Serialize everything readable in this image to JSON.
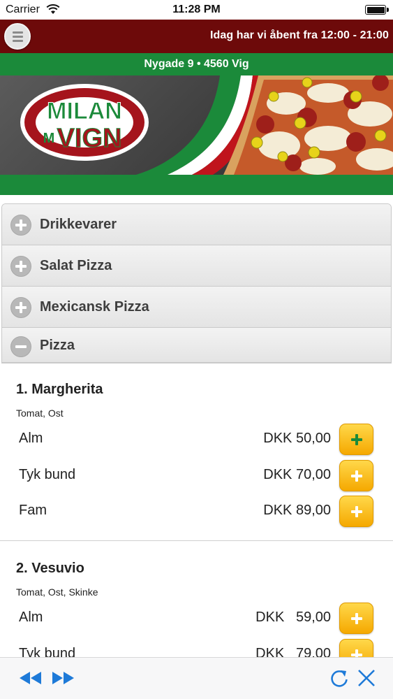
{
  "status_bar": {
    "carrier": "Carrier",
    "time": "11:28 PM",
    "icons": [
      "wifi-icon",
      "battery-icon"
    ]
  },
  "header": {
    "menu_icon": "hamburger-menu-icon",
    "opening_hours": "Idag har vi åbent fra 12:00 - 21:00"
  },
  "address": "Nygade 9 • 4560 Vig",
  "banner": {
    "logo_text_top": "MILAN",
    "logo_text_bottom": "VIGN",
    "logo_text_m": "M"
  },
  "categories": [
    {
      "label": "Drikkevarer",
      "icon": "plus-circle-icon",
      "expanded": false
    },
    {
      "label": "Salat Pizza",
      "icon": "plus-circle-icon",
      "expanded": false
    },
    {
      "label": "Mexicansk Pizza",
      "icon": "plus-circle-icon",
      "expanded": false
    },
    {
      "label": "Pizza",
      "icon": "minus-circle-icon",
      "expanded": true
    }
  ],
  "products": [
    {
      "name": "1. Margherita",
      "description": "Tomat, Ost",
      "variants": [
        {
          "size": "Alm",
          "price": "DKK 50,00"
        },
        {
          "size": "Tyk bund",
          "price": "DKK 70,00"
        },
        {
          "size": "Fam",
          "price": "DKK 89,00"
        }
      ]
    },
    {
      "name": "2. Vesuvio",
      "description": "Tomat, Ost, Skinke",
      "variants": [
        {
          "size": "Alm",
          "price": "DKK   59,00"
        },
        {
          "size": "Tyk bund",
          "price": "DKK   79,00"
        }
      ]
    }
  ],
  "toolbar": {
    "icons": [
      "rewind-icon",
      "fast-forward-icon",
      "refresh-icon",
      "close-icon"
    ]
  },
  "colors": {
    "header_bg": "#6d0a0a",
    "address_bg": "#1b8a3a",
    "add_button": "#f5b400",
    "toolbar_icon": "#1e7ad8"
  }
}
